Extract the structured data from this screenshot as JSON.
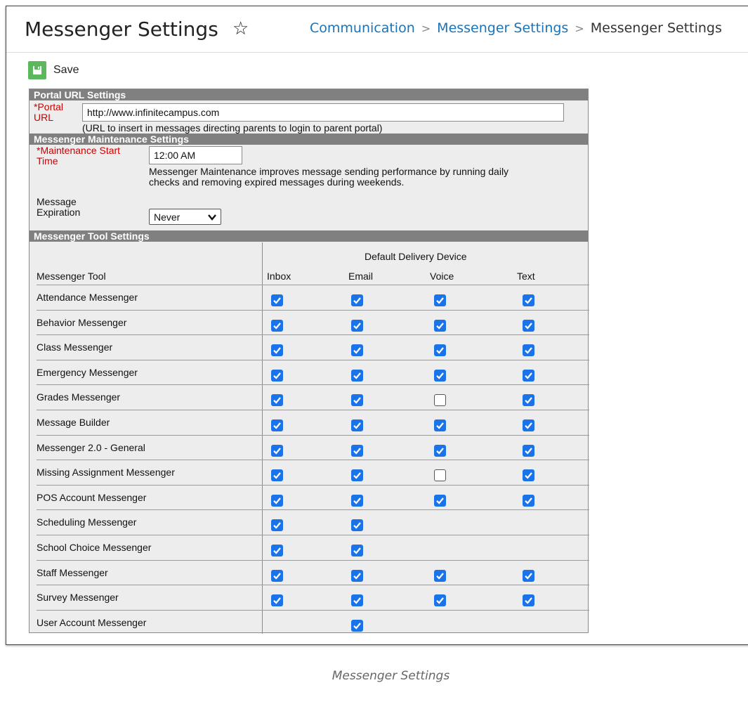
{
  "page": {
    "title": "Messenger Settings",
    "favorite_icon": "star-outline-icon",
    "breadcrumb": [
      "Communication",
      "Messenger Settings",
      "Messenger Settings"
    ]
  },
  "toolbar": {
    "save_label": "Save",
    "save_icon": "floppy-disk-icon"
  },
  "portal": {
    "header": "Portal URL Settings",
    "label_line1": "*Portal",
    "label_line2": "URL",
    "url_value": "http://www.infinitecampus.com",
    "hint": "(URL to insert in messages directing parents to login to parent portal)"
  },
  "maintenance": {
    "header": "Messenger Maintenance Settings",
    "start_label_line1": "*Maintenance Start",
    "start_label_line2": "Time",
    "start_value": "12:00 AM",
    "desc_line1": "Messenger Maintenance improves message sending performance by running daily",
    "desc_line2": "checks and removing expired messages during weekends.",
    "expiration_label_line1": "Message",
    "expiration_label_line2": "Expiration",
    "expiration_value": "Never"
  },
  "tools": {
    "header": "Messenger Tool Settings",
    "group_header": "Default Delivery Device",
    "col_tool": "Messenger Tool",
    "columns": [
      "Inbox",
      "Email",
      "Voice",
      "Text"
    ],
    "rows": [
      {
        "name": "Attendance Messenger",
        "values": [
          true,
          true,
          true,
          true
        ]
      },
      {
        "name": "Behavior Messenger",
        "values": [
          true,
          true,
          true,
          true
        ]
      },
      {
        "name": "Class Messenger",
        "values": [
          true,
          true,
          true,
          true
        ]
      },
      {
        "name": "Emergency Messenger",
        "values": [
          true,
          true,
          true,
          true
        ]
      },
      {
        "name": "Grades Messenger",
        "values": [
          true,
          true,
          false,
          true
        ]
      },
      {
        "name": "Message Builder",
        "values": [
          true,
          true,
          true,
          true
        ]
      },
      {
        "name": "Messenger 2.0 - General",
        "values": [
          true,
          true,
          true,
          true
        ]
      },
      {
        "name": "Missing Assignment Messenger",
        "values": [
          true,
          true,
          false,
          true
        ]
      },
      {
        "name": "POS Account Messenger",
        "values": [
          true,
          true,
          true,
          true
        ]
      },
      {
        "name": "Scheduling Messenger",
        "values": [
          true,
          true,
          null,
          null
        ]
      },
      {
        "name": "School Choice Messenger",
        "values": [
          true,
          true,
          null,
          null
        ]
      },
      {
        "name": "Staff Messenger",
        "values": [
          true,
          true,
          true,
          true
        ]
      },
      {
        "name": "Survey Messenger",
        "values": [
          true,
          true,
          true,
          true
        ]
      },
      {
        "name": "User Account Messenger",
        "values": [
          null,
          true,
          null,
          null
        ]
      }
    ]
  },
  "caption": "Messenger Settings",
  "colors": {
    "accent": "#1a73e8",
    "save_green": "#5cb85c",
    "link": "#1a73b8",
    "section_header": "#808080"
  }
}
